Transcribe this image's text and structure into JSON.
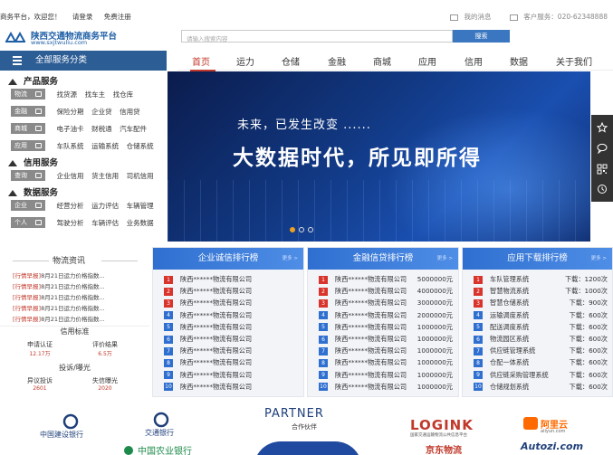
{
  "topbar": {
    "site_name": "商务平台，欢迎您！",
    "login": "请登录",
    "register": "免费注册",
    "messages": "我的消息",
    "service": "客户服务：020-62348888"
  },
  "logo": {
    "name": "陕西交通物流商务平台",
    "url": "www.sxjtwuliu.com"
  },
  "search": {
    "placeholder": "请输入搜索内容",
    "button": "搜索"
  },
  "all_categories": "全部服务分类",
  "sections": {
    "product": "产品服务",
    "credit": "信用服务",
    "data": "数据服务"
  },
  "rows": [
    {
      "tag": "物流",
      "items": [
        "找货源",
        "找车主",
        "找仓库"
      ]
    },
    {
      "tag": "金融",
      "items": [
        "保险分期",
        "企业贷",
        "信用贷"
      ]
    },
    {
      "tag": "商城",
      "items": [
        "电子油卡",
        "财税通",
        "汽车配件"
      ]
    },
    {
      "tag": "应用",
      "items": [
        "车队系统",
        "运输系统",
        "仓储系统"
      ]
    },
    {
      "tag": "查询",
      "items": [
        "企业信用",
        "货主信用",
        "司机信用"
      ]
    },
    {
      "tag": "企业",
      "items": [
        "经营分析",
        "运力评估",
        "车辆管理"
      ]
    },
    {
      "tag": "个人",
      "items": [
        "驾驶分析",
        "车辆评估",
        "业务数据"
      ]
    }
  ],
  "nav": [
    "首页",
    "运力",
    "仓储",
    "金融",
    "商城",
    "应用",
    "信用",
    "数据",
    "关于我们"
  ],
  "banner": {
    "line1": "未来，已发生改变 ......",
    "line2": "大数据时代，所见即所得"
  },
  "news": {
    "title": "物流资讯",
    "tag": "[行情早报]",
    "items": [
      "8月21日运力价格指数...",
      "8月21日运力价格指数...",
      "8月21日运力价格指数...",
      "8月21日运力价格指数...",
      "8月21日运力价格指数..."
    ]
  },
  "credit_std": {
    "title": "信用标准",
    "a_label": "申请认证",
    "a_value": "12.17万",
    "b_label": "评价结果",
    "b_value": "6.5万"
  },
  "complaint": {
    "title": "投诉/曝光",
    "a_label": "异议投诉",
    "a_value": "2601",
    "b_label": "失信曝光",
    "b_value": "2020"
  },
  "panel1": {
    "title": "企业诚信排行榜",
    "more": "更多 >",
    "rows": [
      "陕西******物流有限公司",
      "陕西******物流有限公司",
      "陕西******物流有限公司",
      "陕西******物流有限公司",
      "陕西******物流有限公司",
      "陕西******物流有限公司",
      "陕西******物流有限公司",
      "陕西******物流有限公司",
      "陕西******物流有限公司",
      "陕西******物流有限公司"
    ]
  },
  "panel2": {
    "title": "金融信贷排行榜",
    "more": "更多 >",
    "rows": [
      {
        "n": "陕西******物流有限公司",
        "v": "5000000元"
      },
      {
        "n": "陕西******物流有限公司",
        "v": "4000000元"
      },
      {
        "n": "陕西******物流有限公司",
        "v": "3000000元"
      },
      {
        "n": "陕西******物流有限公司",
        "v": "2000000元"
      },
      {
        "n": "陕西******物流有限公司",
        "v": "1000000元"
      },
      {
        "n": "陕西******物流有限公司",
        "v": "1000000元"
      },
      {
        "n": "陕西******物流有限公司",
        "v": "1000000元"
      },
      {
        "n": "陕西******物流有限公司",
        "v": "1000000元"
      },
      {
        "n": "陕西******物流有限公司",
        "v": "1000000元"
      },
      {
        "n": "陕西******物流有限公司",
        "v": "1000000元"
      }
    ]
  },
  "panel3": {
    "title": "应用下载排行榜",
    "more": "更多 >",
    "rows": [
      {
        "n": "车队管理系统",
        "v": "下载：1200次"
      },
      {
        "n": "智慧物流系统",
        "v": "下载：1000次"
      },
      {
        "n": "智慧仓储系统",
        "v": "下载：900次"
      },
      {
        "n": "运输调度系统",
        "v": "下载：600次"
      },
      {
        "n": "配送调度系统",
        "v": "下载：600次"
      },
      {
        "n": "物流园区系统",
        "v": "下载：600次"
      },
      {
        "n": "供应链管理系统",
        "v": "下载：600次"
      },
      {
        "n": "仓配一体系统",
        "v": "下载：600次"
      },
      {
        "n": "供应链采购管理系统",
        "v": "下载：600次"
      },
      {
        "n": "仓储规划系统",
        "v": "下载：600次"
      }
    ]
  },
  "partners": {
    "title": "PARTNER",
    "sub": "合作伙伴",
    "ccb": "中国建设银行",
    "comm": "交通银行",
    "abc": "中国农业银行",
    "logink": "LOGINK",
    "logink_sub": "国家交通运输物流公共信息平台",
    "jd": "京东物流",
    "ali": "阿里云",
    "ali_sub": "aliyun.com",
    "autozi": "Autozi.com"
  },
  "colors": {
    "brand_blue": "#2c5d95",
    "accent_red": "#c0392b",
    "panel_blue": "#2f6fd0"
  }
}
